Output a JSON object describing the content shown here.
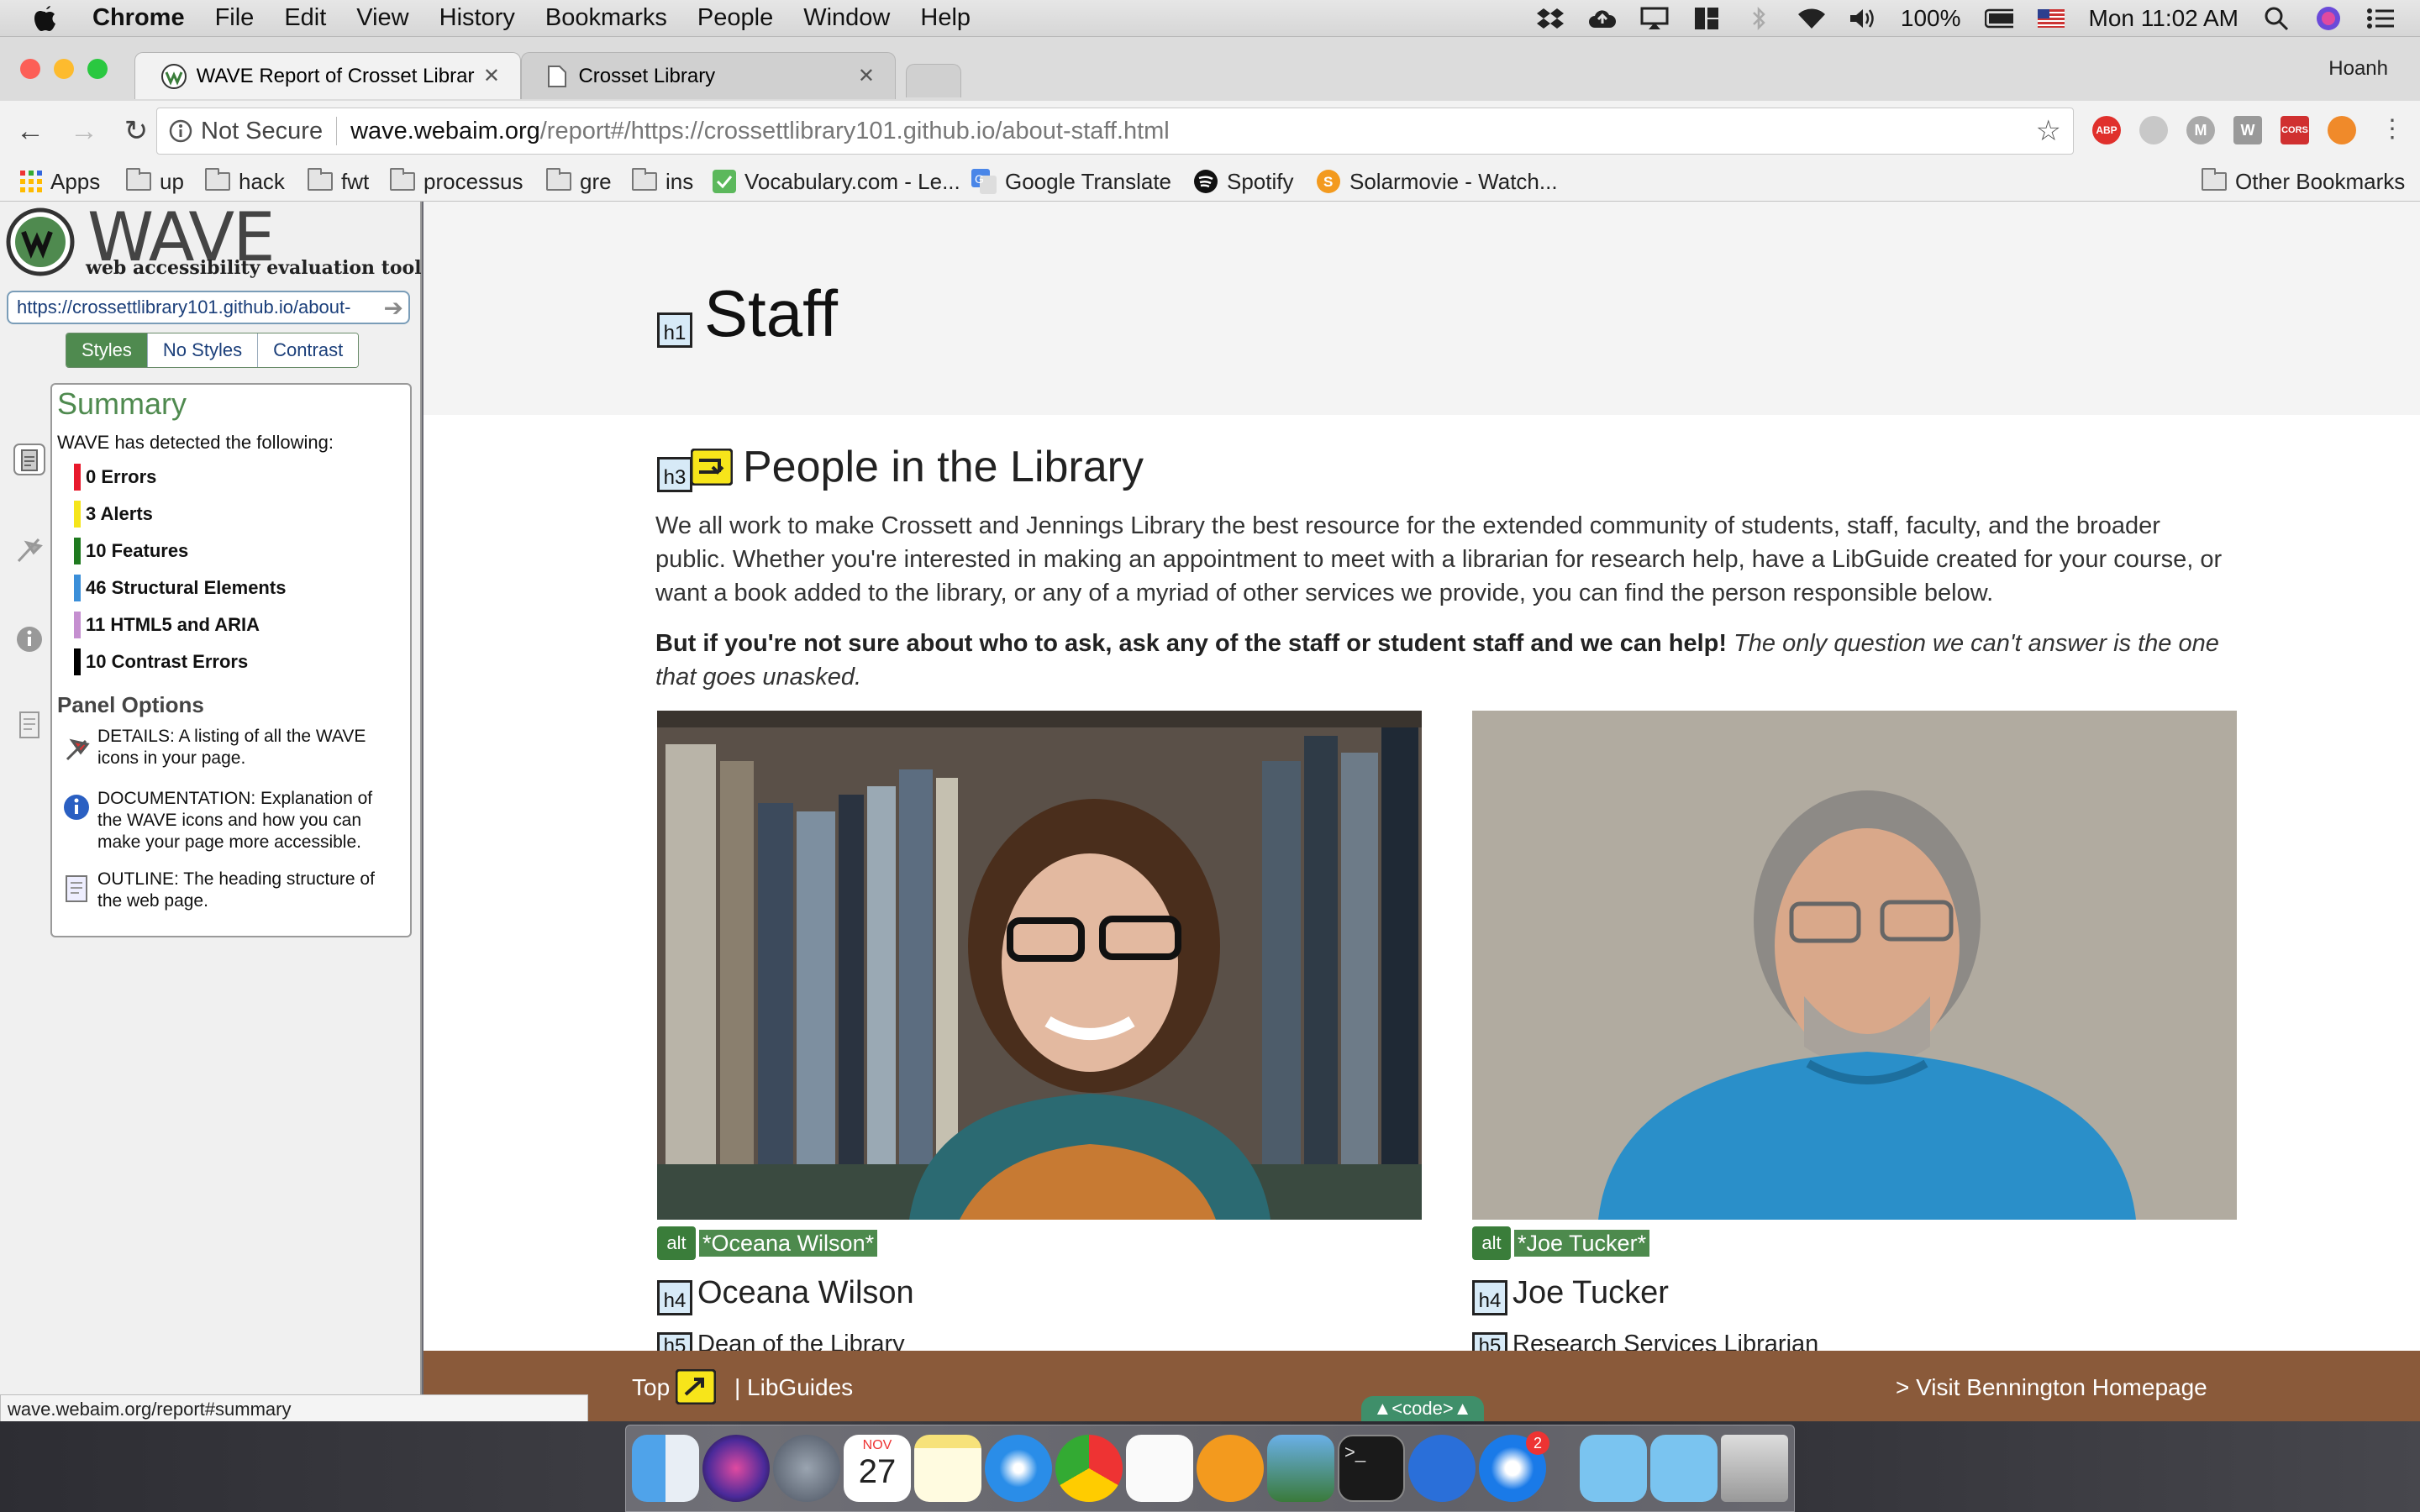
{
  "menubar": {
    "app": "Chrome",
    "items": [
      "File",
      "Edit",
      "View",
      "History",
      "Bookmarks",
      "People",
      "Window",
      "Help"
    ],
    "battery": "100%",
    "clock": "Mon 11:02 AM"
  },
  "tabs": [
    {
      "title": "WAVE Report of Crosset Librar"
    },
    {
      "title": "Crosset Library"
    }
  ],
  "profile": "Hoanh",
  "omnibox": {
    "security": "Not Secure",
    "url_host": "wave.webaim.org",
    "url_path": "/report#/https://crossettlibrary101.github.io/about-staff.html"
  },
  "extensions": [
    "ABP",
    "drive",
    "M",
    "W",
    "CORS",
    "fox"
  ],
  "bookmarks": {
    "items": [
      "Apps",
      "up",
      "hack",
      "fwt",
      "processus",
      "gre",
      "ins",
      "Vocabulary.com - Le...",
      "Google Translate",
      "Spotify",
      "Solarmovie - Watch..."
    ],
    "other": "Other Bookmarks"
  },
  "wave": {
    "title": "WAVE",
    "tagline": "web accessibility evaluation tool",
    "url_value": "https://crossettlibrary101.github.io/about-",
    "view_tabs": [
      "Styles",
      "No Styles",
      "Contrast"
    ],
    "summary_title": "Summary",
    "summary_intro": "WAVE has detected the following:",
    "summary_rows": [
      {
        "text": "0 Errors",
        "color": "#e8192c"
      },
      {
        "text": "3 Alerts",
        "color": "#f5e51b"
      },
      {
        "text": "10 Features",
        "color": "#1f7a1f"
      },
      {
        "text": "46 Structural Elements",
        "color": "#3b8fd9"
      },
      {
        "text": "11 HTML5 and ARIA",
        "color": "#c58fd0"
      },
      {
        "text": "10 Contrast Errors",
        "color": "#000000"
      }
    ],
    "panel_options_title": "Panel Options",
    "panel_options": [
      "DETAILS: A listing of all the WAVE icons in your page.",
      "DOCUMENTATION: Explanation of the WAVE icons and how you can make your page more accessible.",
      "OUTLINE: The heading structure of the web page."
    ]
  },
  "page": {
    "h1_badge": "h1",
    "title": "Staff",
    "h3_badge": "h3",
    "section_heading": "People in the Library",
    "intro": "We all work to make Crossett and Jennings Library the best resource for the extended community of students, staff, faculty, and the broader public. Whether you're interested in making an appointment to meet with a librarian for research help, have a LibGuide created for your course, or want a book added to the library, or any of a myriad of other services we provide, you can find the person responsible below.",
    "callout_bold": "But if you're not sure about who to ask, ask any of the staff or student staff and we can help!",
    "callout_italic": "The only question we can't answer is the one that goes unasked.",
    "people": [
      {
        "alt_badge": "alt",
        "alt": "*Oceana Wilson*",
        "h4": "h4",
        "name": "Oceana Wilson",
        "h5": "h5",
        "role": "Dean of the Library"
      },
      {
        "alt_badge": "alt",
        "alt": "*Joe Tucker*",
        "h4": "h4",
        "name": "Joe Tucker",
        "h5": "h5",
        "role": "Research Services Librarian"
      }
    ]
  },
  "footer": {
    "top": "Top",
    "libguides": "| LibGuides",
    "visit": "> Visit Bennington Homepage",
    "code_tab": "▲<code>▲"
  },
  "statusbar": "wave.webaim.org/report#summary",
  "dock": {
    "calendar_day": "27",
    "calendar_month": "NOV",
    "badge": "2"
  }
}
